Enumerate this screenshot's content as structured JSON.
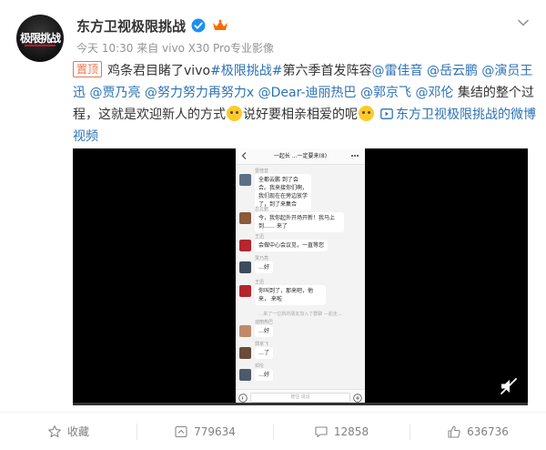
{
  "post": {
    "username": "东方卫视极限挑战",
    "avatar_text": "极限挑战",
    "meta": "今天 10:30 来自 vivo X30 Pro专业影像",
    "pinned_label": "置顶",
    "text": {
      "intro": "鸡条君目睹了vivo",
      "hashtag": "#极限挑战#",
      "season": "第六季首发阵容",
      "mention_1": "@雷佳音",
      "mention_2": "@岳云鹏",
      "mention_3": "@演员王迅",
      "mention_4": "@贾乃亮",
      "mention_5": "@努力努力再努力x",
      "mention_6": "@Dear-迪丽热巴",
      "mention_7": "@郭京飞",
      "mention_8": "@邓伦",
      "body_1": " 集结的整个过程，这就是欢迎新人的方式",
      "body_2": "说好要相亲相爱的呢",
      "video_link": "东方卫视极限挑战的微博视频"
    }
  },
  "video": {
    "progress": 0.0,
    "chat": {
      "header": "一起长 ...一定要来(8)",
      "messages": [
        {
          "sender": "雷佳音",
          "text": "全都云鹏 到了会合。我来接你们啊，我们现在在旁边放学了，到了来集合"
        },
        {
          "sender": "岳云鹏",
          "text": "今，我你起外开场开新！我马上到……  来了"
        },
        {
          "sender": "王迅",
          "text": "会做中心会议见，一直等您"
        },
        {
          "sender": "贾乃亮",
          "text": "…好"
        },
        {
          "sender": "王迅",
          "text": "你叫到了，那来吧，他来，  来啦"
        }
      ],
      "system_note": "…来了一位新的朋友加入了群聊 —起走…",
      "messages_2": [
        {
          "sender": "迪丽热巴",
          "text": "…好"
        },
        {
          "sender": "郭京飞",
          "text": "…了"
        },
        {
          "sender": "邓伦",
          "text": "…好"
        }
      ],
      "input_placeholder": "按住 说话"
    }
  },
  "actions": {
    "favorite_label": "收藏",
    "repost_count": "779634",
    "comment_count": "12858",
    "like_count": "636736"
  },
  "colors": {
    "accent_orange": "#eb7350",
    "link_blue": "#2d72b5",
    "verified_blue": "#1d8ff2"
  }
}
